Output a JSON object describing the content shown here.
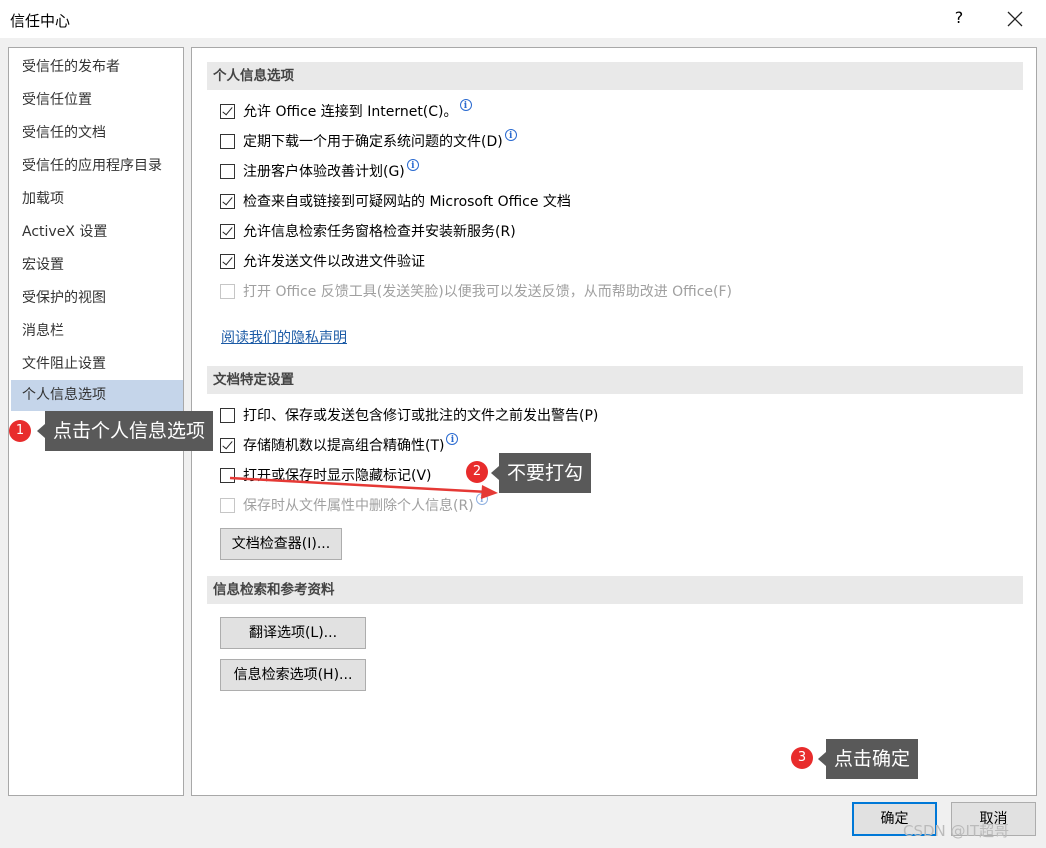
{
  "window": {
    "title": "信任中心",
    "help_label": "?",
    "close_label": "close"
  },
  "sidebar": {
    "items": [
      {
        "label": "受信任的发布者"
      },
      {
        "label": "受信任位置"
      },
      {
        "label": "受信任的文档"
      },
      {
        "label": "受信任的应用程序目录"
      },
      {
        "label": "加载项"
      },
      {
        "label": "ActiveX 设置"
      },
      {
        "label": "宏设置"
      },
      {
        "label": "受保护的视图"
      },
      {
        "label": "消息栏"
      },
      {
        "label": "文件阻止设置"
      },
      {
        "label": "个人信息选项",
        "selected": true
      }
    ]
  },
  "sections": {
    "personal": {
      "title": "个人信息选项",
      "options": [
        {
          "label": "允许 Office 连接到 Internet(C)。",
          "checked": true,
          "info": true,
          "disabled": false
        },
        {
          "label": "定期下载一个用于确定系统问题的文件(D)",
          "checked": false,
          "info": true,
          "disabled": false
        },
        {
          "label": "注册客户体验改善计划(G)",
          "checked": false,
          "info": true,
          "disabled": false
        },
        {
          "label": "检查来自或链接到可疑网站的 Microsoft Office 文档",
          "checked": true,
          "info": false,
          "disabled": false
        },
        {
          "label": "允许信息检索任务窗格检查并安装新服务(R)",
          "checked": true,
          "info": false,
          "disabled": false
        },
        {
          "label": "允许发送文件以改进文件验证",
          "checked": true,
          "info": false,
          "disabled": false
        },
        {
          "label": "打开 Office 反馈工具(发送笑脸)以便我可以发送反馈，从而帮助改进 Office(F)",
          "checked": false,
          "info": false,
          "disabled": true
        }
      ],
      "privacy_link": "阅读我们的隐私声明"
    },
    "document": {
      "title": "文档特定设置",
      "options": [
        {
          "label": "打印、保存或发送包含修订或批注的文件之前发出警告(P)",
          "checked": false,
          "info": false,
          "disabled": false
        },
        {
          "label": "存储随机数以提高组合精确性(T)",
          "checked": true,
          "info": true,
          "disabled": false
        },
        {
          "label": "打开或保存时显示隐藏标记(V)",
          "checked": false,
          "info": false,
          "disabled": false
        },
        {
          "label": "保存时从文件属性中删除个人信息(R)",
          "checked": false,
          "info": true,
          "disabled": true
        }
      ],
      "inspector_button": "文档检查器(I)..."
    },
    "research": {
      "title": "信息检索和参考资料",
      "translate_button": "翻译选项(L)...",
      "research_button": "信息检索选项(H)..."
    }
  },
  "footer": {
    "ok_label": "确定",
    "cancel_label": "取消"
  },
  "annotations": [
    {
      "number": "1",
      "text": "点击个人信息选项"
    },
    {
      "number": "2",
      "text": "不要打勾"
    },
    {
      "number": "3",
      "text": "点击确定"
    }
  ],
  "watermark": "CSDN @IT超哥",
  "colors": {
    "selected_bg": "#c5d5ea",
    "badge_red": "#e82c2c",
    "tooltip_bg": "#595959",
    "link_blue": "#1c5ba6",
    "arrow_red": "#e53935"
  }
}
